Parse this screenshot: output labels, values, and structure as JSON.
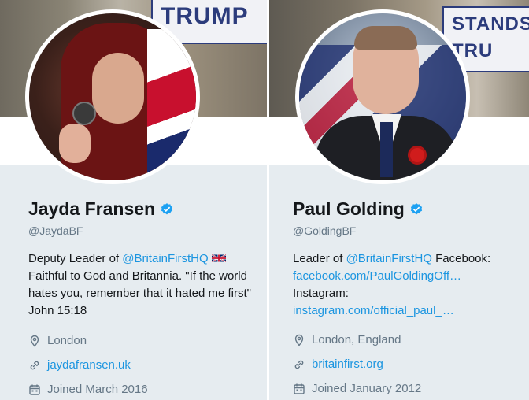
{
  "profiles": [
    {
      "name": "Jayda Fransen",
      "handle": "@JaydaBF",
      "bio": {
        "prefix": "Deputy Leader of ",
        "mention": "@BritainFirstHQ",
        "rest": "Faithful to God and Britannia. \"If the world hates you, remember that it hated me first\" John 15:18"
      },
      "location": "London",
      "website": "jaydafransen.uk",
      "joined": "Joined March 2016",
      "banner_text": "TRUMP"
    },
    {
      "name": "Paul Golding",
      "handle": "@GoldingBF",
      "bio": {
        "prefix": "Leader of ",
        "mention": "@BritainFirstHQ",
        "after_mention": " Facebook:",
        "link1": "facebook.com/PaulGoldingOff…",
        "line3": "Instagram:",
        "link2": "instagram.com/official_paul_…"
      },
      "location": "London, England",
      "website": "britainfirst.org",
      "joined": "Joined January 2012",
      "banner_text_1": "STANDS",
      "banner_text_2": "TRU"
    }
  ],
  "colors": {
    "accent": "#1b95e0",
    "verified": "#1da1f2",
    "muted": "#657786",
    "card_bg": "#e6ecf0"
  },
  "icons": [
    "verified-badge-icon",
    "location-pin-icon",
    "link-icon",
    "calendar-icon",
    "uk-flag-icon"
  ]
}
